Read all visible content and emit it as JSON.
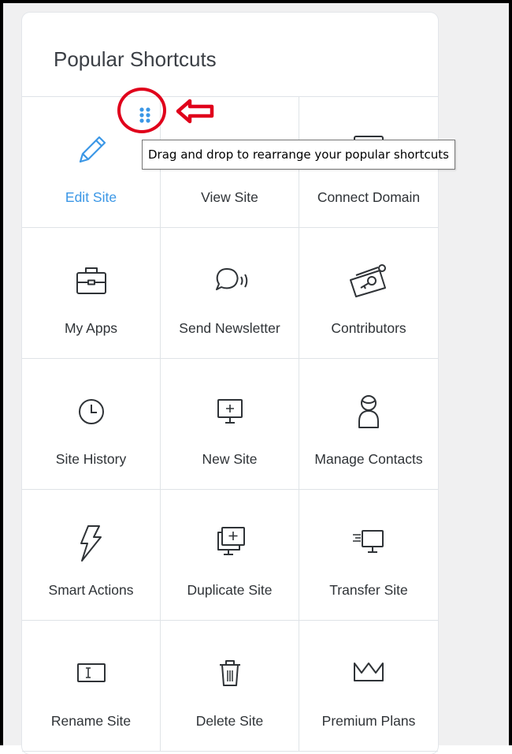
{
  "panel": {
    "title": "Popular Shortcuts"
  },
  "tooltip": {
    "text": "Drag and drop to rearrange your popular shortcuts"
  },
  "colors": {
    "accent": "#3b97e6",
    "annotation": "#e0001b",
    "text": "#2f3337",
    "divider": "#dfe3e7"
  },
  "shortcuts": [
    {
      "label": "Edit Site",
      "icon": "pencil-icon",
      "active": true
    },
    {
      "label": "View Site",
      "icon": "eye-icon"
    },
    {
      "label": "Connect Domain",
      "icon": "monitor-icon"
    },
    {
      "label": "My Apps",
      "icon": "briefcase-icon"
    },
    {
      "label": "Send Newsletter",
      "icon": "speech-bubble-icon"
    },
    {
      "label": "Contributors",
      "icon": "key-card-icon"
    },
    {
      "label": "Site History",
      "icon": "clock-icon"
    },
    {
      "label": "New Site",
      "icon": "monitor-plus-icon"
    },
    {
      "label": "Manage Contacts",
      "icon": "person-icon"
    },
    {
      "label": "Smart Actions",
      "icon": "lightning-icon"
    },
    {
      "label": "Duplicate Site",
      "icon": "duplicate-monitor-icon"
    },
    {
      "label": "Transfer Site",
      "icon": "transfer-monitor-icon"
    },
    {
      "label": "Rename Site",
      "icon": "text-cursor-icon"
    },
    {
      "label": "Delete Site",
      "icon": "trash-icon"
    },
    {
      "label": "Premium Plans",
      "icon": "crown-icon"
    }
  ]
}
